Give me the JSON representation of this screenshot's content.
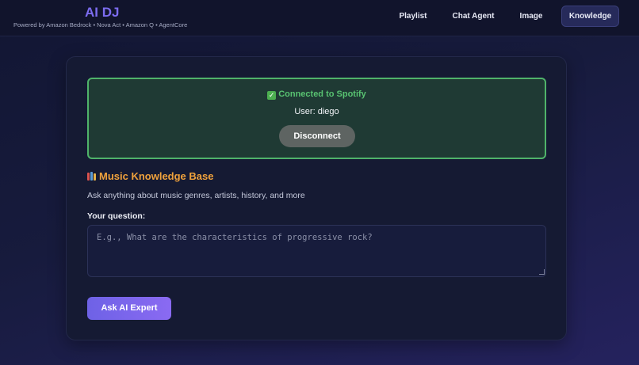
{
  "header": {
    "title": "AI DJ",
    "subtitle": "Powered by Amazon Bedrock • Nova Act • Amazon Q • AgentCore",
    "nav": [
      {
        "label": "Playlist",
        "active": false
      },
      {
        "label": "Chat Agent",
        "active": false
      },
      {
        "label": "Image",
        "active": false
      },
      {
        "label": "Knowledge",
        "active": true
      }
    ]
  },
  "spotify": {
    "status_icon": "check-icon",
    "status": "Connected to Spotify",
    "user": "User: diego",
    "disconnect_label": "Disconnect"
  },
  "knowledge": {
    "icon": "books-icon",
    "title": "Music Knowledge Base",
    "description": "Ask anything about music genres, artists, history, and more",
    "question_label": "Your question:",
    "question_value": "",
    "question_placeholder": "E.g., What are the characteristics of progressive rock?",
    "ask_label": "Ask AI Expert"
  },
  "colors": {
    "accent": "#7c6cf0",
    "connected_green": "#58c271",
    "section_title": "#f0a23c"
  }
}
